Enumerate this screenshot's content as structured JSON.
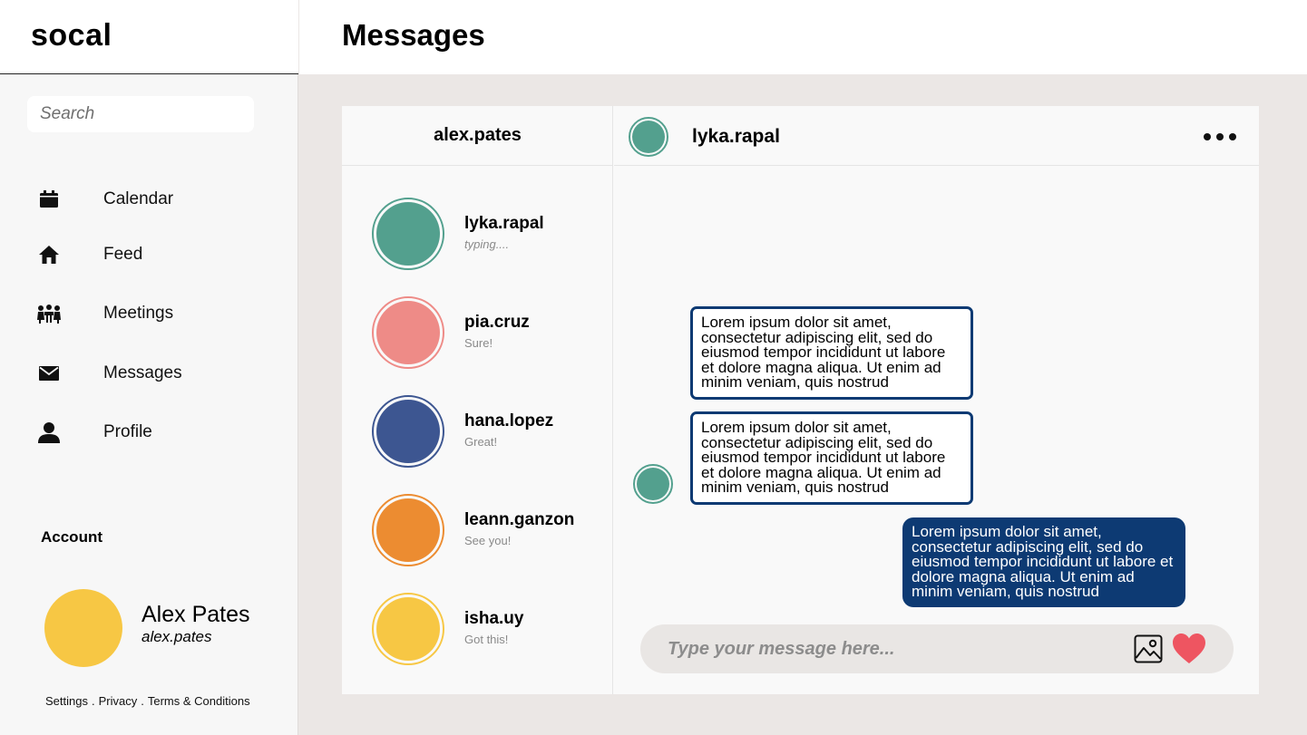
{
  "brand": "socal",
  "header": {
    "title": "Messages"
  },
  "sidebar": {
    "search_placeholder": "Search",
    "items": [
      {
        "label": "Calendar",
        "icon": "calendar-icon"
      },
      {
        "label": "Feed",
        "icon": "home-icon"
      },
      {
        "label": "Meetings",
        "icon": "meetings-icon"
      },
      {
        "label": "Messages",
        "icon": "mail-icon"
      },
      {
        "label": "Profile",
        "icon": "user-icon"
      }
    ],
    "account": {
      "title": "Account",
      "name": "Alex Pates",
      "handle": "alex.pates",
      "avatar_color": "#f7c744"
    },
    "footer": [
      "Settings",
      ".",
      "Privacy",
      ".",
      "Terms & Conditions"
    ]
  },
  "conversations": {
    "owner": "alex.pates",
    "items": [
      {
        "name": "lyka.rapal",
        "preview": "typing....",
        "color": "#53a08e"
      },
      {
        "name": "pia.cruz",
        "preview": "Sure!",
        "color": "#ee8b87"
      },
      {
        "name": "hana.lopez",
        "preview": "Great!",
        "color": "#3d5691"
      },
      {
        "name": "leann.ganzon",
        "preview": "See you!",
        "color": "#ec8c31"
      },
      {
        "name": "isha.uy",
        "preview": "Got this!",
        "color": "#f7c744"
      }
    ]
  },
  "chat": {
    "contact": "lyka.rapal",
    "contact_color": "#53a08e",
    "messages": [
      {
        "direction": "in",
        "text": "Lorem ipsum dolor sit amet, consectetur adipiscing elit, sed do eiusmod tempor incididunt ut labore et dolore magna aliqua. Ut enim ad minim veniam, quis nostrud"
      },
      {
        "direction": "in",
        "text": "Lorem ipsum dolor sit amet, consectetur adipiscing elit, sed do eiusmod tempor incididunt ut labore et dolore magna aliqua. Ut enim ad minim veniam, quis nostrud"
      },
      {
        "direction": "out",
        "text": "Lorem ipsum dolor sit amet, consectetur adipiscing elit, sed do eiusmod tempor incididunt ut labore et dolore magna aliqua. Ut enim ad minim veniam, quis nostrud"
      }
    ],
    "composer_placeholder": "Type your message here...",
    "accent_color": "#0d3a73",
    "heart_color": "#ee5561"
  }
}
